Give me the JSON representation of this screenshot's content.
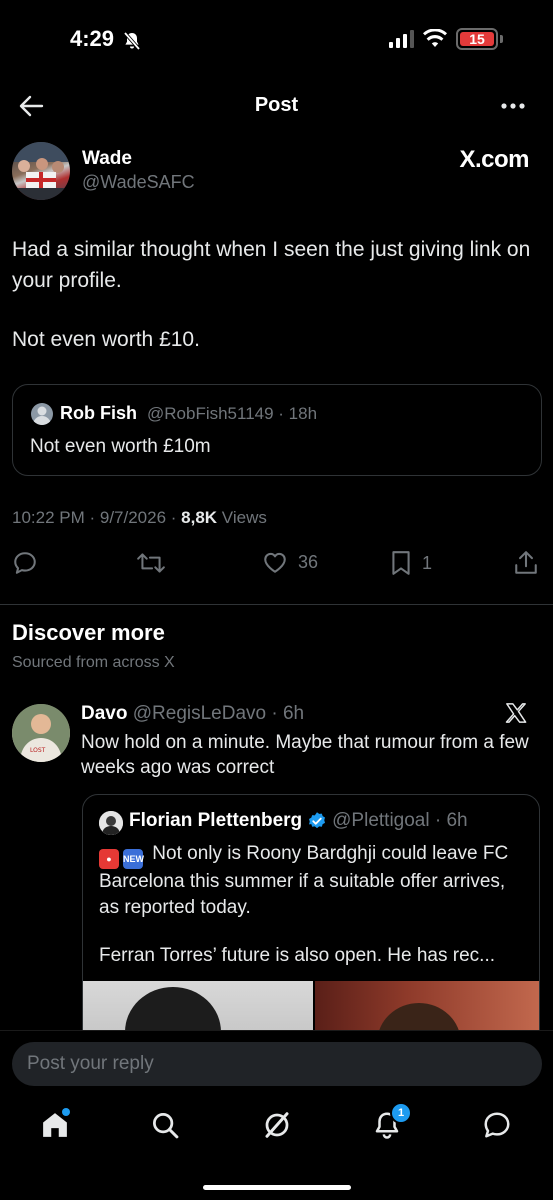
{
  "status": {
    "time": "4:29",
    "battery": "15"
  },
  "header": {
    "title": "Post"
  },
  "tweet": {
    "name": "Wade",
    "handle": "@WadeSAFC",
    "brand": "X.com",
    "text_p1": "Had a similar thought when I seen the just giving link on your profile.",
    "text_p2": "Not even worth £10.",
    "quote": {
      "name": "Rob Fish",
      "meta": "@RobFish51149 · 18h",
      "text": "Not even worth £10m"
    },
    "meta": {
      "time": "10:22 PM · 9/7/2026 · ",
      "views_count": "8,8K",
      "views_label": " Views"
    },
    "actions": {
      "likes": "36",
      "bookmarks": "1"
    }
  },
  "discover": {
    "title": "Discover more",
    "subtitle": "Sourced from across X"
  },
  "feed_post": {
    "name": "Davo",
    "meta": "@RegisLeDavo · 6h",
    "text": "Now hold on a minute. Maybe that rumour from a few weeks ago was correct",
    "quote": {
      "name": "Florian Plettenberg",
      "meta": "@Plettigoal · 6h",
      "text_line1": "Not only is Roony Bardghji could leave FC Barcelona this summer if a suitable offer arrives, as reported today.",
      "text_line2": "Ferran Torres’ future is also open. He has rec...",
      "new_label": "NEW"
    }
  },
  "reply": {
    "placeholder": "Post your reply"
  },
  "nav": {
    "notifications_badge": "1"
  },
  "colors": {
    "accent": "#1d9bf0",
    "muted": "#71767b",
    "border": "#2f3336",
    "battery_low": "#e33a3a"
  }
}
